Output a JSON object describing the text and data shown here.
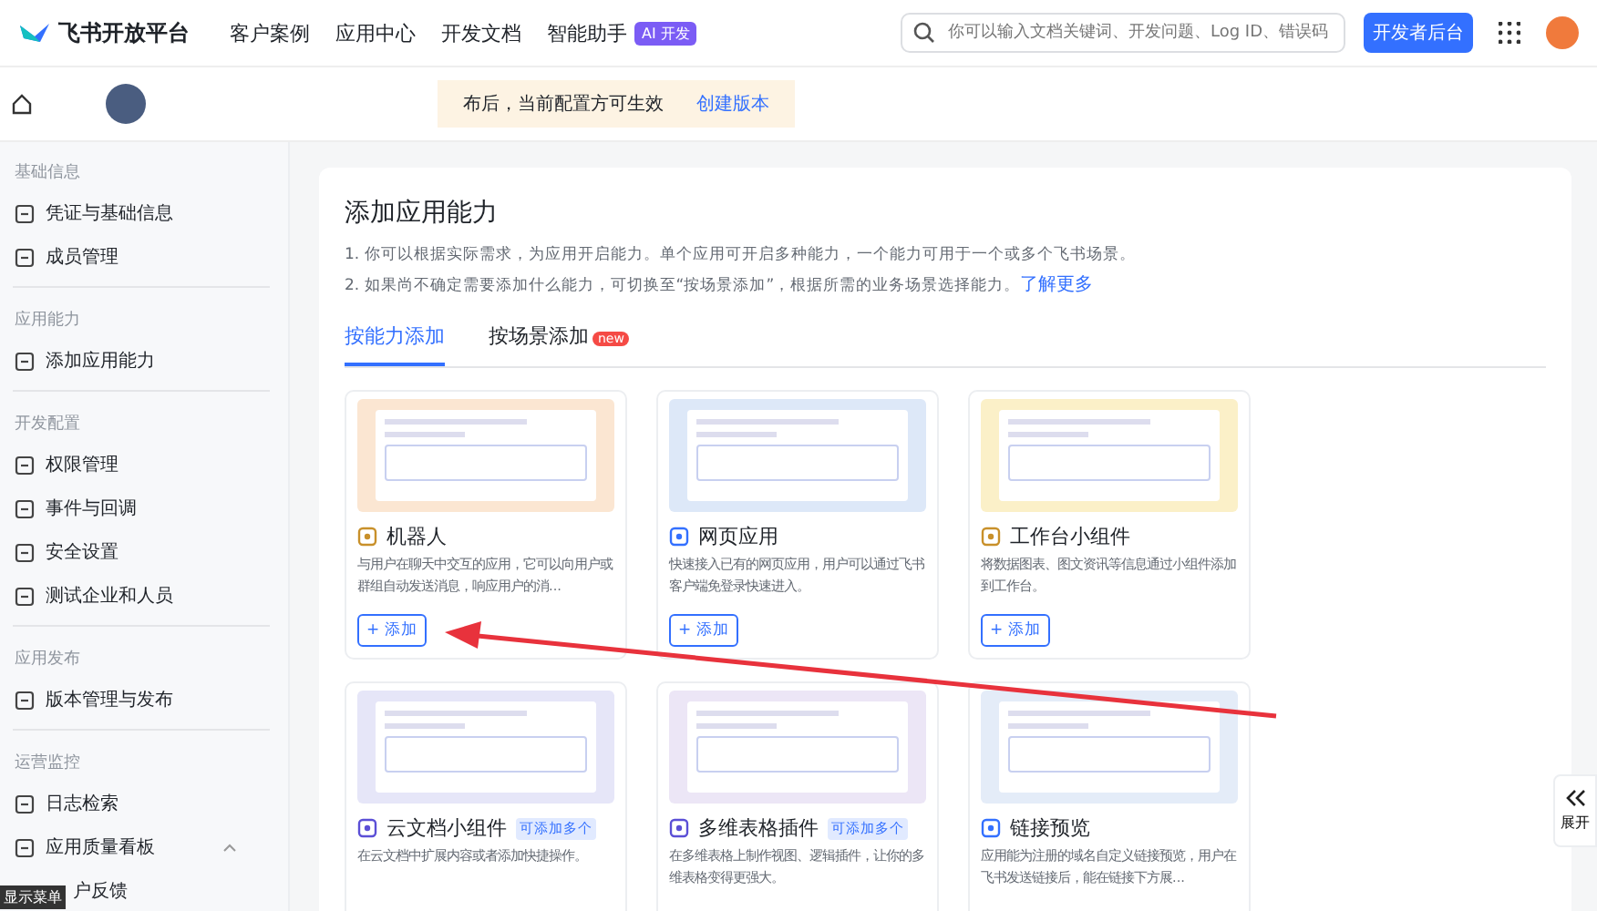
{
  "top_nav": {
    "logo_text": "飞书开放平台",
    "links": [
      "客户案例",
      "应用中心",
      "开发文档",
      "智能助手"
    ],
    "ai_badge": "AI 开发",
    "search": {
      "placeholder": "你可以输入文档关键词、开发问题、Log ID、错误码"
    },
    "console_button": "开发者后台"
  },
  "notice_bar": {
    "text": "布后，当前配置方可生效",
    "link": "创建版本"
  },
  "sidebar": {
    "sections": [
      {
        "title": "基础信息",
        "items": [
          {
            "label": "凭证与基础信息",
            "selected": false
          },
          {
            "label": "成员管理",
            "selected": false
          }
        ]
      },
      {
        "title": "应用能力",
        "items": [
          {
            "label": "添加应用能力",
            "selected": false
          }
        ]
      },
      {
        "title": "开发配置",
        "items": [
          {
            "label": "权限管理",
            "selected": false
          },
          {
            "label": "事件与回调",
            "selected": false
          },
          {
            "label": "安全设置",
            "selected": false
          },
          {
            "label": "测试企业和人员",
            "selected": false
          }
        ]
      },
      {
        "title": "应用发布",
        "items": [
          {
            "label": "版本管理与发布",
            "selected": false
          }
        ]
      },
      {
        "title": "运营监控",
        "items": [
          {
            "label": "日志检索",
            "selected": false
          },
          {
            "label": "应用质量看板",
            "selected": false,
            "expanded": true
          },
          {
            "label": "户反馈",
            "selected": false
          }
        ]
      }
    ],
    "menu_tag": "显示菜单"
  },
  "panel": {
    "title": "添加应用能力",
    "notes": [
      "1. 你可以根据实际需求，为应用开启能力。单个应用可开启多种能力，一个能力可用于一个或多个飞书场景。",
      "2. 如果尚不确定需要添加什么能力，可切换至“按场景添加”，根据所需的业务场景选择能力。"
    ],
    "notes_link": "了解更多",
    "tabs": [
      {
        "label": "按能力添加",
        "selected": true
      },
      {
        "label": "按场景添加",
        "selected": false,
        "badge": "new"
      }
    ],
    "cards": [
      {
        "title": "机器人",
        "desc": "与用户在聊天中交互的应用，它可以向用户或群组自动发送消息，响应用户的消...",
        "button": "+ 添加"
      },
      {
        "title": "网页应用",
        "desc": "快速接入已有的网页应用，用户可以通过飞书客户端免登录快速进入。",
        "button": "+ 添加"
      },
      {
        "title": "工作台小组件",
        "desc": "将数据图表、图文资讯等信息通过小组件添加到工作台。",
        "button": "+ 添加"
      },
      {
        "title": "云文档小组件",
        "tag": "可添加多个",
        "desc": "在云文档中扩展内容或者添加快捷操作。"
      },
      {
        "title": "多维表格插件",
        "tag": "可添加多个",
        "desc": "在多维表格上制作视图、逻辑插件，让你的多维表格变得更强大。"
      },
      {
        "title": "链接预览",
        "desc": "应用能为注册的域名自定义链接预览，用户在飞书发送链接后，能在链接下方展..."
      }
    ]
  },
  "expand_button": "展开"
}
